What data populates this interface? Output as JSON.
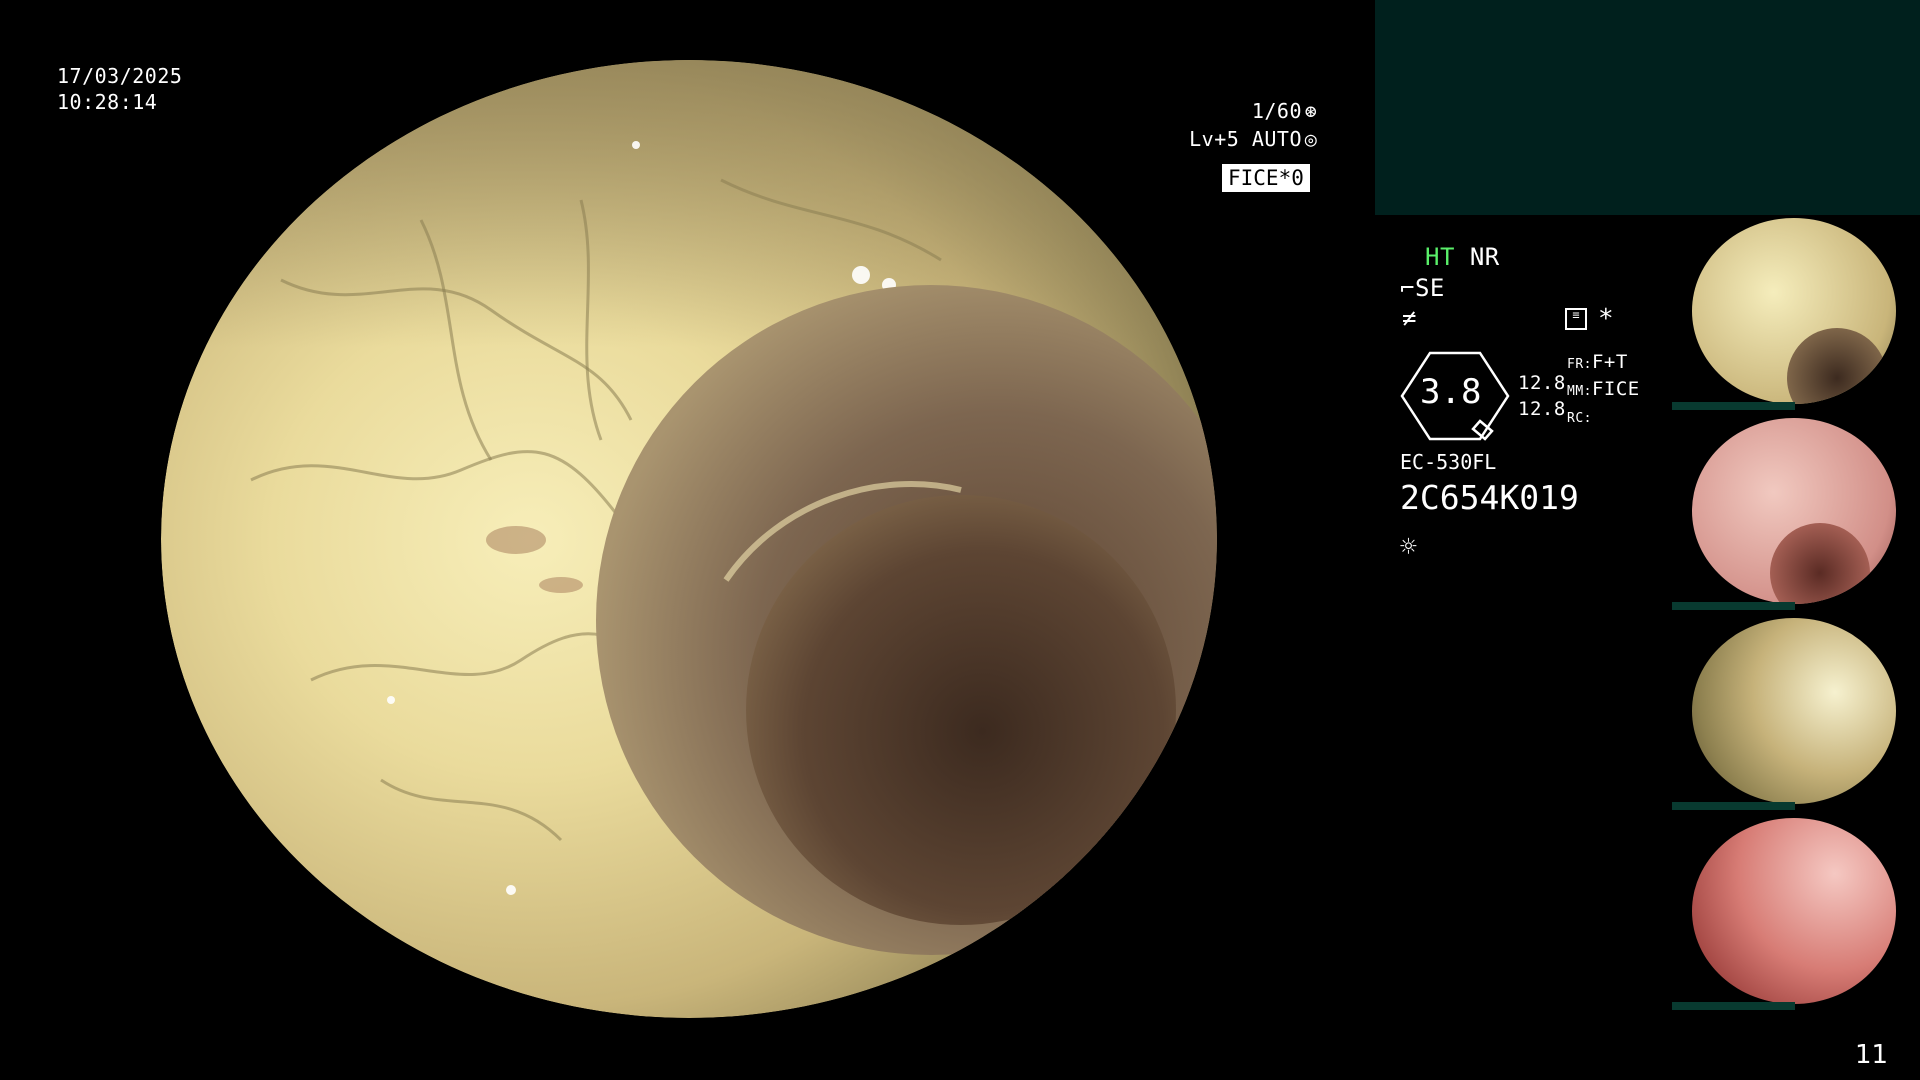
{
  "overlay": {
    "date": "17/03/2025",
    "time": "10:28:14",
    "shutter": "1/60",
    "exposure_level": "Lv+5",
    "exposure_mode": "AUTO",
    "fice_label": "FICE",
    "fice_value": "0"
  },
  "info": {
    "ht": "HT",
    "nr": "NR",
    "se": "SE",
    "level_value": "3.8",
    "left_val_1": "12.8",
    "left_val_2": "12.8",
    "fr_label": "FR:",
    "fr_value": "F+T",
    "mm_label": "MM:",
    "mm_value": "FICE",
    "rc_label": "RC:",
    "scope_model": "EC-530FL",
    "serial": "2C654K019",
    "star": "*"
  },
  "thumbnails": [
    {
      "name": "thumbnail-1",
      "tone": "yellow"
    },
    {
      "name": "thumbnail-2",
      "tone": "pink"
    },
    {
      "name": "thumbnail-3",
      "tone": "olive"
    },
    {
      "name": "thumbnail-4",
      "tone": "red"
    }
  ],
  "page_number": "11",
  "colors": {
    "accent_green": "#5af06a",
    "panel_bg": "#00201d",
    "bar": "#083a30"
  },
  "icons": [
    "shutter-icon",
    "auto-exposure-icon",
    "scope-se-icon",
    "filter-icon",
    "memo-icon",
    "light-icon",
    "level-gauge-icon"
  ]
}
